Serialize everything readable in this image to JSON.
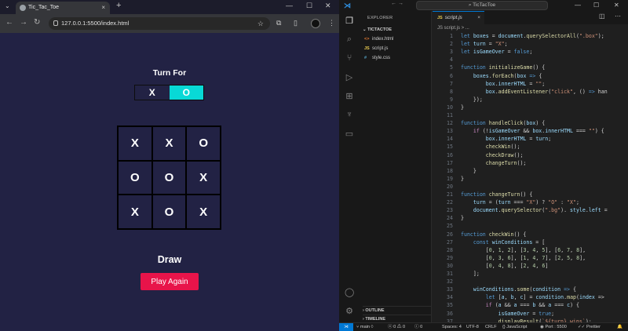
{
  "browser": {
    "tab_title": "Tic_Tac_Toe",
    "tab_close": "×",
    "new_tab": "+",
    "url": "127.0.0.1:5500/index.html",
    "window_controls": [
      "—",
      "☐",
      "✕"
    ]
  },
  "game": {
    "turn_title": "Turn For",
    "turn_x": "X",
    "turn_o": "O",
    "active_turn": "O",
    "active_color": "#08d9d6",
    "board": [
      "X",
      "X",
      "O",
      "O",
      "O",
      "X",
      "X",
      "O",
      "X"
    ],
    "result": "Draw",
    "play_again": "Play Again",
    "button_color": "#e8144a",
    "page_background": "#222244"
  },
  "vscode": {
    "search": "TicTacToe",
    "explorer_title": "EXPLORER",
    "folder": "TICTACTOE",
    "files": [
      {
        "icon": "<>",
        "name": "index.html",
        "color": "#e37933"
      },
      {
        "icon": "JS",
        "name": "script.js",
        "color": "#e6c84f"
      },
      {
        "icon": "#",
        "name": "style.css",
        "color": "#519aba"
      }
    ],
    "outline": "OUTLINE",
    "timeline": "TIMELINE",
    "active_tab": "script.js",
    "breadcrumb": "JS script.js > ...",
    "code": [
      [
        [
          "kw",
          "let "
        ],
        [
          "var",
          "boxes"
        ],
        [
          "p",
          " = "
        ],
        [
          "var",
          "document"
        ],
        [
          "p",
          "."
        ],
        [
          "fn",
          "querySelectorAll"
        ],
        [
          "p",
          "("
        ],
        [
          "str",
          "\".box\""
        ],
        [
          "p",
          ");"
        ]
      ],
      [
        [
          "kw",
          "let "
        ],
        [
          "var",
          "turn"
        ],
        [
          "p",
          " = "
        ],
        [
          "str",
          "\"X\""
        ],
        [
          "p",
          ";"
        ]
      ],
      [
        [
          "kw",
          "let "
        ],
        [
          "var",
          "isGameOver"
        ],
        [
          "p",
          " = "
        ],
        [
          "kw",
          "false"
        ],
        [
          "p",
          ";"
        ]
      ],
      [],
      [
        [
          "kw",
          "function "
        ],
        [
          "fn",
          "initializeGame"
        ],
        [
          "p",
          "() {"
        ]
      ],
      [
        [
          "p",
          "    "
        ],
        [
          "var",
          "boxes"
        ],
        [
          "p",
          "."
        ],
        [
          "fn",
          "forEach"
        ],
        [
          "p",
          "("
        ],
        [
          "var",
          "box"
        ],
        [
          "p",
          " "
        ],
        [
          "kw",
          "=>"
        ],
        [
          "p",
          " {"
        ]
      ],
      [
        [
          "p",
          "        "
        ],
        [
          "var",
          "box"
        ],
        [
          "p",
          "."
        ],
        [
          "var",
          "innerHTML"
        ],
        [
          "p",
          " = "
        ],
        [
          "str",
          "\"\""
        ],
        [
          "p",
          ";"
        ]
      ],
      [
        [
          "p",
          "        "
        ],
        [
          "var",
          "box"
        ],
        [
          "p",
          "."
        ],
        [
          "fn",
          "addEventListener"
        ],
        [
          "p",
          "("
        ],
        [
          "str",
          "\"click\""
        ],
        [
          "p",
          ", () "
        ],
        [
          "kw",
          "=>"
        ],
        [
          "p",
          " han"
        ]
      ],
      [
        [
          "p",
          "    });"
        ]
      ],
      [
        [
          "p",
          "}"
        ]
      ],
      [],
      [
        [
          "kw",
          "function "
        ],
        [
          "fn",
          "handleClick"
        ],
        [
          "p",
          "("
        ],
        [
          "var",
          "box"
        ],
        [
          "p",
          ") {"
        ]
      ],
      [
        [
          "p",
          "    "
        ],
        [
          "ctl",
          "if"
        ],
        [
          "p",
          " (!"
        ],
        [
          "var",
          "isGameOver"
        ],
        [
          "p",
          " && "
        ],
        [
          "var",
          "box"
        ],
        [
          "p",
          "."
        ],
        [
          "var",
          "innerHTML"
        ],
        [
          "p",
          " === "
        ],
        [
          "str",
          "\"\""
        ],
        [
          "p",
          ") {"
        ]
      ],
      [
        [
          "p",
          "        "
        ],
        [
          "var",
          "box"
        ],
        [
          "p",
          "."
        ],
        [
          "var",
          "innerHTML"
        ],
        [
          "p",
          " = "
        ],
        [
          "var",
          "turn"
        ],
        [
          "p",
          ";"
        ]
      ],
      [
        [
          "p",
          "        "
        ],
        [
          "fn",
          "checkWin"
        ],
        [
          "p",
          "();"
        ]
      ],
      [
        [
          "p",
          "        "
        ],
        [
          "fn",
          "checkDraw"
        ],
        [
          "p",
          "();"
        ]
      ],
      [
        [
          "p",
          "        "
        ],
        [
          "fn",
          "changeTurn"
        ],
        [
          "p",
          "();"
        ]
      ],
      [
        [
          "p",
          "    }"
        ]
      ],
      [
        [
          "p",
          "}"
        ]
      ],
      [],
      [
        [
          "kw",
          "function "
        ],
        [
          "fn",
          "changeTurn"
        ],
        [
          "p",
          "() {"
        ]
      ],
      [
        [
          "p",
          "    "
        ],
        [
          "var",
          "turn"
        ],
        [
          "p",
          " = ("
        ],
        [
          "var",
          "turn"
        ],
        [
          "p",
          " === "
        ],
        [
          "str",
          "\"X\""
        ],
        [
          "p",
          ") ? "
        ],
        [
          "str",
          "\"O\""
        ],
        [
          "p",
          " : "
        ],
        [
          "str",
          "\"X\""
        ],
        [
          "p",
          ";"
        ]
      ],
      [
        [
          "p",
          "    "
        ],
        [
          "var",
          "document"
        ],
        [
          "p",
          "."
        ],
        [
          "fn",
          "querySelector"
        ],
        [
          "p",
          "("
        ],
        [
          "str",
          "\".bg\""
        ],
        [
          "p",
          "). "
        ],
        [
          "var",
          "style"
        ],
        [
          "p",
          "."
        ],
        [
          "var",
          "left"
        ],
        [
          "p",
          " ="
        ]
      ],
      [
        [
          "p",
          "}"
        ]
      ],
      [],
      [
        [
          "kw",
          "function "
        ],
        [
          "fn",
          "checkWin"
        ],
        [
          "p",
          "() {"
        ]
      ],
      [
        [
          "p",
          "    "
        ],
        [
          "kw",
          "const "
        ],
        [
          "var",
          "winConditions"
        ],
        [
          "p",
          " = ["
        ]
      ],
      [
        [
          "p",
          "        ["
        ],
        [
          "num",
          "0"
        ],
        [
          "p",
          ", "
        ],
        [
          "num",
          "1"
        ],
        [
          "p",
          ", "
        ],
        [
          "num",
          "2"
        ],
        [
          "p",
          "], ["
        ],
        [
          "num",
          "3"
        ],
        [
          "p",
          ", "
        ],
        [
          "num",
          "4"
        ],
        [
          "p",
          ", "
        ],
        [
          "num",
          "5"
        ],
        [
          "p",
          "], ["
        ],
        [
          "num",
          "6"
        ],
        [
          "p",
          ", "
        ],
        [
          "num",
          "7"
        ],
        [
          "p",
          ", "
        ],
        [
          "num",
          "8"
        ],
        [
          "p",
          "],"
        ]
      ],
      [
        [
          "p",
          "        ["
        ],
        [
          "num",
          "0"
        ],
        [
          "p",
          ", "
        ],
        [
          "num",
          "3"
        ],
        [
          "p",
          ", "
        ],
        [
          "num",
          "6"
        ],
        [
          "p",
          "], ["
        ],
        [
          "num",
          "1"
        ],
        [
          "p",
          ", "
        ],
        [
          "num",
          "4"
        ],
        [
          "p",
          ", "
        ],
        [
          "num",
          "7"
        ],
        [
          "p",
          "], ["
        ],
        [
          "num",
          "2"
        ],
        [
          "p",
          ", "
        ],
        [
          "num",
          "5"
        ],
        [
          "p",
          ", "
        ],
        [
          "num",
          "8"
        ],
        [
          "p",
          "],"
        ]
      ],
      [
        [
          "p",
          "        ["
        ],
        [
          "num",
          "0"
        ],
        [
          "p",
          ", "
        ],
        [
          "num",
          "4"
        ],
        [
          "p",
          ", "
        ],
        [
          "num",
          "8"
        ],
        [
          "p",
          "], ["
        ],
        [
          "num",
          "2"
        ],
        [
          "p",
          ", "
        ],
        [
          "num",
          "4"
        ],
        [
          "p",
          ", "
        ],
        [
          "num",
          "6"
        ],
        [
          "p",
          "]"
        ]
      ],
      [
        [
          "p",
          "    ];"
        ]
      ],
      [],
      [
        [
          "p",
          "    "
        ],
        [
          "var",
          "winConditions"
        ],
        [
          "p",
          "."
        ],
        [
          "fn",
          "some"
        ],
        [
          "p",
          "("
        ],
        [
          "var",
          "condition"
        ],
        [
          "p",
          " "
        ],
        [
          "kw",
          "=>"
        ],
        [
          "p",
          " {"
        ]
      ],
      [
        [
          "p",
          "        "
        ],
        [
          "kw",
          "let "
        ],
        [
          "p",
          "["
        ],
        [
          "var",
          "a"
        ],
        [
          "p",
          ", "
        ],
        [
          "var",
          "b"
        ],
        [
          "p",
          ", "
        ],
        [
          "var",
          "c"
        ],
        [
          "p",
          "] = "
        ],
        [
          "var",
          "condition"
        ],
        [
          "p",
          "."
        ],
        [
          "fn",
          "map"
        ],
        [
          "p",
          "("
        ],
        [
          "var",
          "index"
        ],
        [
          "p",
          " =>"
        ]
      ],
      [
        [
          "p",
          "        "
        ],
        [
          "ctl",
          "if"
        ],
        [
          "p",
          " ("
        ],
        [
          "var",
          "a"
        ],
        [
          "p",
          " && "
        ],
        [
          "var",
          "a"
        ],
        [
          "p",
          " === "
        ],
        [
          "var",
          "b"
        ],
        [
          "p",
          " && "
        ],
        [
          "var",
          "a"
        ],
        [
          "p",
          " === "
        ],
        [
          "var",
          "c"
        ],
        [
          "p",
          ") {"
        ]
      ],
      [
        [
          "p",
          "            "
        ],
        [
          "var",
          "isGameOver"
        ],
        [
          "p",
          " = "
        ],
        [
          "kw",
          "true"
        ],
        [
          "p",
          ";"
        ]
      ],
      [
        [
          "p",
          "            "
        ],
        [
          "fn",
          "displayResult"
        ],
        [
          "p",
          "("
        ],
        [
          "str",
          "`${turn} wins`"
        ],
        [
          "p",
          ");"
        ]
      ]
    ],
    "status": {
      "branch": "main",
      "errors": "0",
      "warnings": "0",
      "info": "0",
      "spaces": "Spaces: 4",
      "encoding": "UTF-8",
      "eol": "CRLF",
      "language": "JavaScript",
      "port": "Port : 5500",
      "formatter": "Prettier"
    }
  }
}
